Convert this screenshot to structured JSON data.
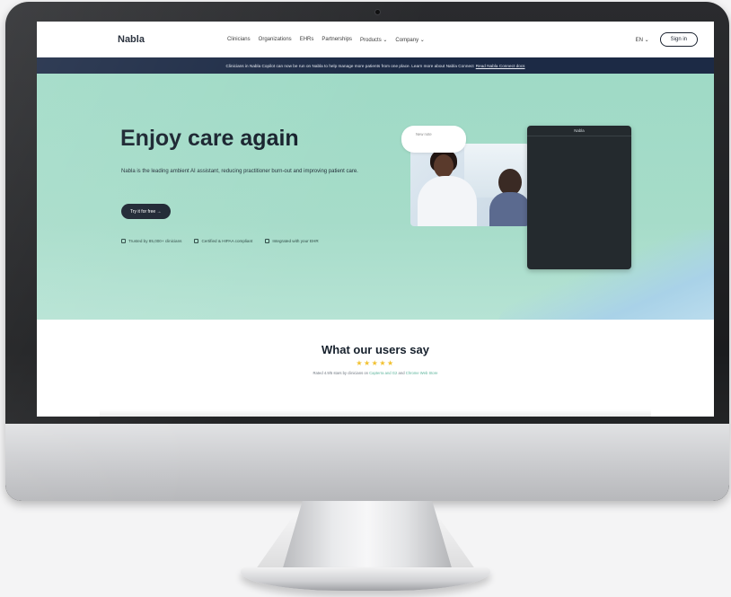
{
  "nav": {
    "logo": "Nabla",
    "links": [
      "Clinicians",
      "Organizations",
      "EHRs",
      "Partnerships",
      "Products ⌄",
      "Company ⌄"
    ],
    "lang": "EN ⌄",
    "signin_label": "Sign in"
  },
  "banner": {
    "text": "Clinicians in Nabla Copilot can now be run on Nabla to help manage more patients from one place. Learn more about Nabla Connect",
    "link": "Read Nabla Connect docs"
  },
  "hero": {
    "title": "Enjoy care again",
    "subtitle": "Nabla is the leading ambient AI assistant, reducing practitioner burn-out and improving patient care.",
    "cta_label": "Try it for free →",
    "trust": [
      "Trusted by 85,000+ clinicians",
      "Certified & HIPAA compliant",
      "Integrated with your EHR"
    ],
    "bubble_text": "New note",
    "panel_title": "Nabla"
  },
  "reviews": {
    "title": "What our users say",
    "stars": "★★★★★",
    "note_prefix": "Rated 4.9/5 stars by clinicians on",
    "note_link1": "Capterra and G2",
    "note_mid": "and",
    "note_link2": "Chrome Web Store"
  },
  "colors": {
    "hero_bg": "#a6dcc9",
    "banner_bg": "#1c2a45",
    "cta_bg": "#1b2330",
    "star": "#f2c130"
  }
}
